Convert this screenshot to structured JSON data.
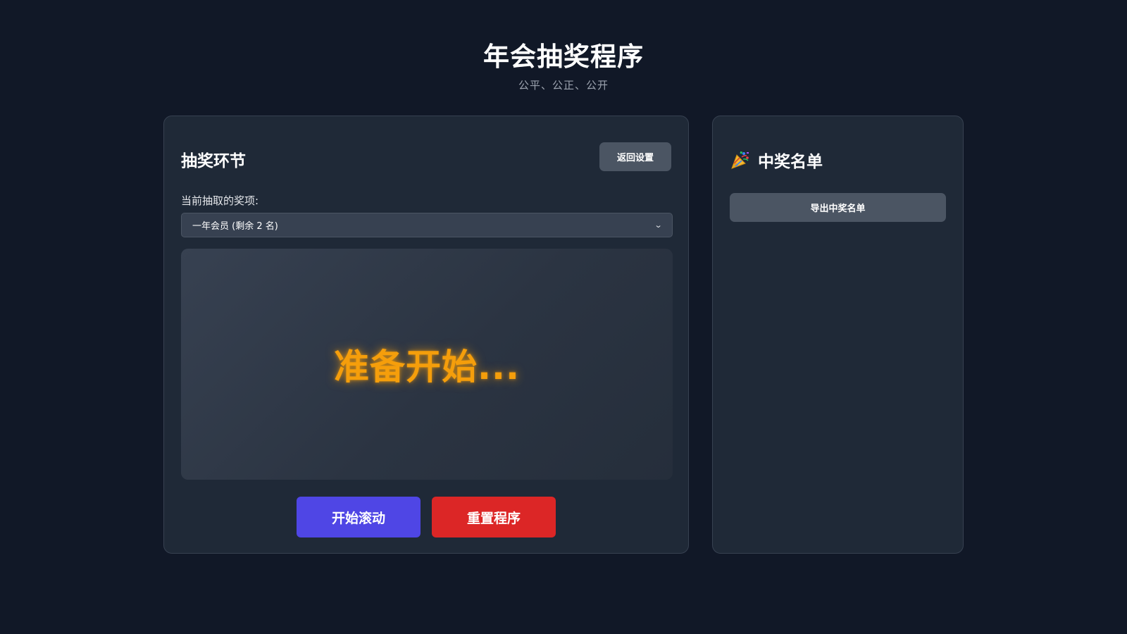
{
  "header": {
    "title": "年会抽奖程序",
    "subtitle": "公平、公正、公开"
  },
  "draw_panel": {
    "title": "抽奖环节",
    "back_button_label": "返回设置",
    "prize_label": "当前抽取的奖项:",
    "prize_select": {
      "selected": "一年会员 (剩余 2 名)"
    },
    "display_text": "准备开始...",
    "start_button_label": "开始滚动",
    "reset_button_label": "重置程序"
  },
  "winners_panel": {
    "icon": "party-popper-icon",
    "title": "中奖名单",
    "export_button_label": "导出中奖名单",
    "winners": []
  },
  "colors": {
    "background": "#111827",
    "panel": "#1f2937",
    "accent_primary": "#4f46e5",
    "accent_danger": "#dc2626",
    "highlight": "#f59e0b",
    "neutral_button": "#4b5563"
  }
}
